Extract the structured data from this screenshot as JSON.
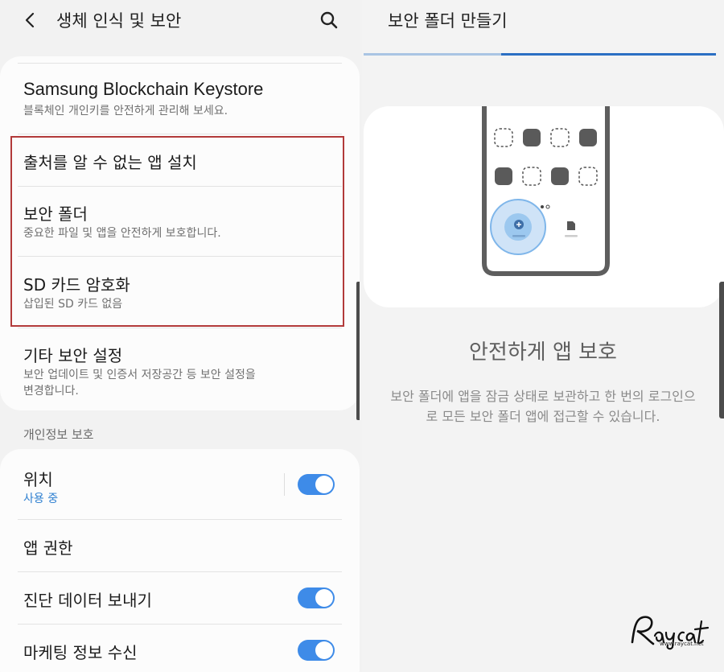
{
  "left": {
    "header": {
      "title": "생체 인식 및 보안"
    },
    "card1": {
      "keystore": {
        "title": "Samsung Blockchain Keystore",
        "subtitle": "블록체인 개인키를 안전하게 관리해 보세요."
      },
      "unknown_apps": {
        "title": "출처를 알 수 없는 앱 설치"
      },
      "secure_folder": {
        "title": "보안 폴더",
        "subtitle": "중요한 파일 및 앱을 안전하게 보호합니다."
      },
      "sd_encrypt": {
        "title": "SD 카드 암호화",
        "subtitle": "삽입된 SD 카드 없음"
      },
      "other_security": {
        "title": "기타 보안 설정",
        "subtitle_line1": "보안 업데이트 및 인증서 저장공간 등 보안 설정을",
        "subtitle_line2": "변경합니다."
      }
    },
    "privacy_section": {
      "label": "개인정보 보호"
    },
    "card2": {
      "location": {
        "title": "위치",
        "status": "사용 중",
        "toggle_on": true
      },
      "app_permissions": {
        "title": "앱 권한"
      },
      "diagnostic": {
        "title": "진단 데이터 보내기",
        "toggle_on": true
      },
      "marketing": {
        "title": "마케팅 정보 수신",
        "toggle_on": true
      }
    }
  },
  "right": {
    "header": {
      "title": "보안 폴더 만들기"
    },
    "progress": {
      "value": 0.61
    },
    "headline": "안전하게 앱 보호",
    "description": "보안 폴더에 앱을 잠금 상태로 보관하고 한 번의 로그인으로 모든 보안 폴더 앱에 접근할 수 있습니다."
  },
  "colors": {
    "accent": "#3e8be8",
    "highlight_border": "#b23a3a",
    "progress": "#2b6fc3",
    "status_text": "#2d7fd0"
  },
  "watermark": {
    "brand": "Raycat",
    "site": "www.raycat.net"
  }
}
